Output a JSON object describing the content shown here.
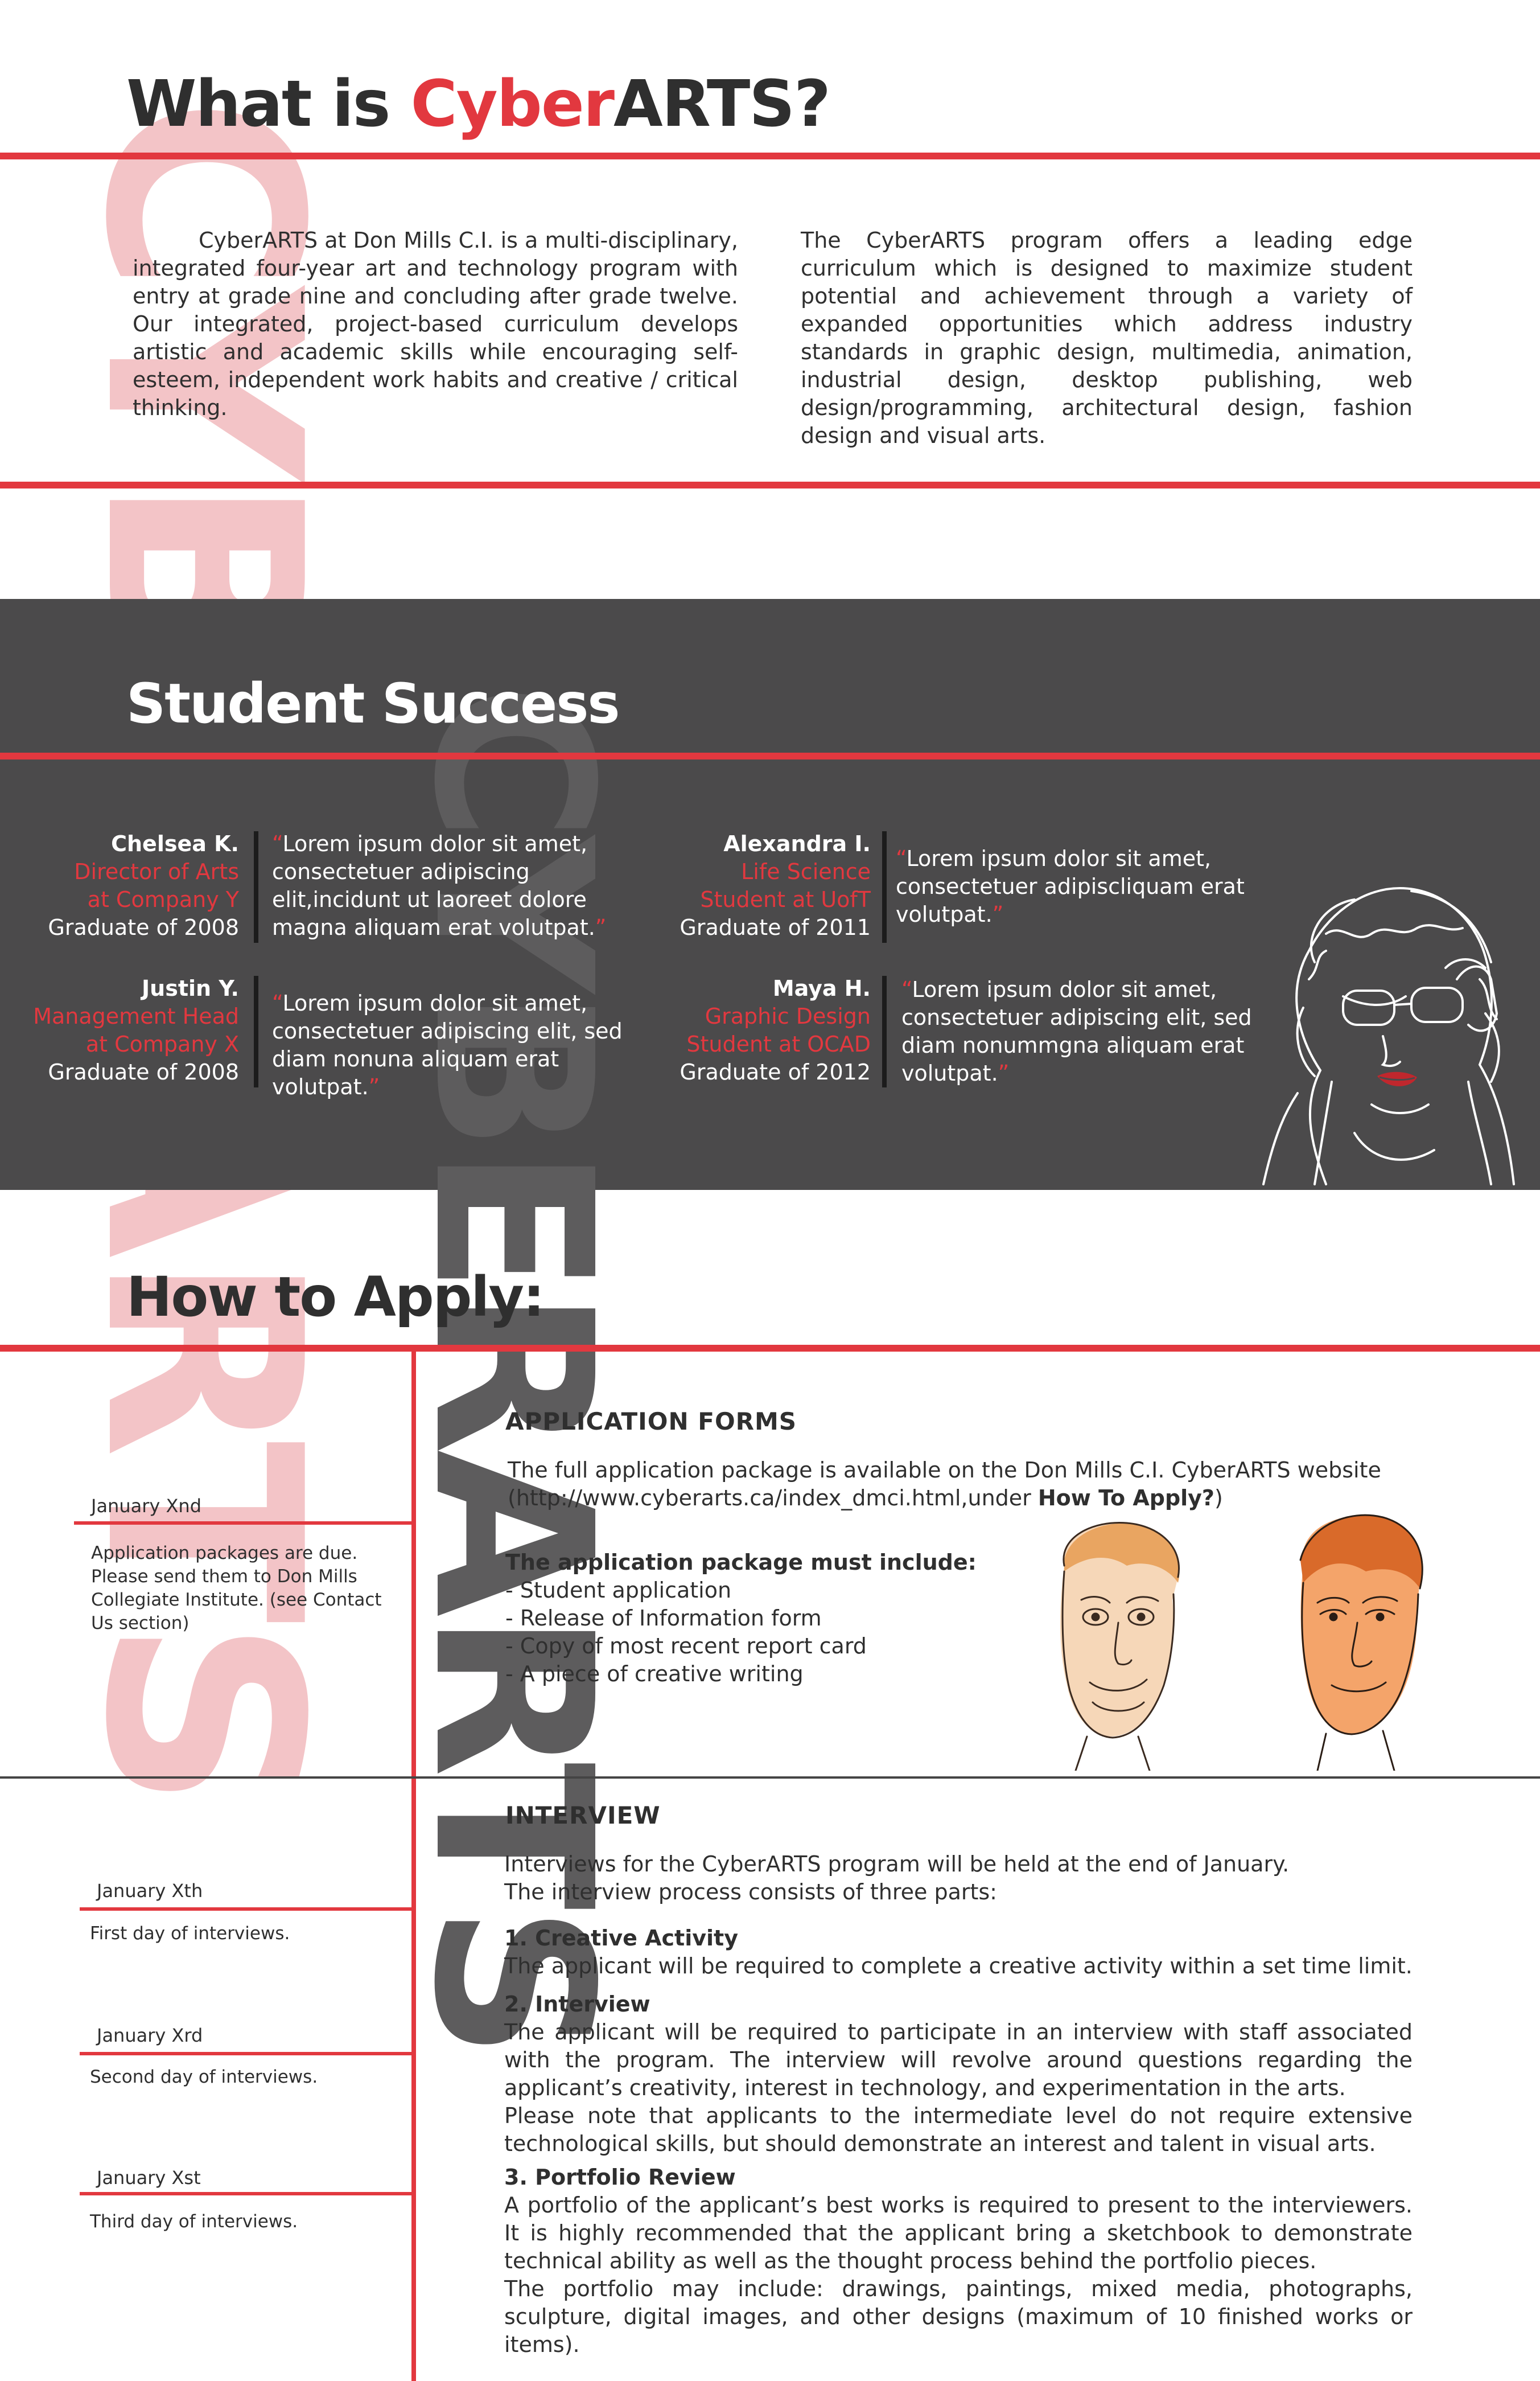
{
  "watermark": {
    "red": "CYBERARTS",
    "grey": "CYBERARTS"
  },
  "intro": {
    "title_pre": "What is ",
    "title_accent": "Cyber",
    "title_post": "ARTS?",
    "col1": "CyberARTS at Don Mills C.I. is a multi-disciplinary, integrated four-year art and technology program with entry at grade nine and concluding after grade twelve. Our integrated, project-based curriculum develops artistic and academic skills while encouraging self-esteem, independent work habits and creative / critical thinking.",
    "col2": "The CyberARTS program offers a leading edge curriculum which is designed to maximize student potential and achievement through a variety of expanded opportunities which address industry standards in graphic design, multimedia, animation, industrial design, desktop publishing, web design/programming, architectural design, fashion design and visual arts."
  },
  "success": {
    "title": "Student Success",
    "students": [
      {
        "name": "Chelsea K.",
        "role_line1": "Director of Arts",
        "role_line2": "at Company Y",
        "grad": "Graduate of 2008",
        "quote_open": "“",
        "quote": "Lorem ipsum dolor sit amet, consectetuer adipiscing elit,incidunt ut laoreet dolore magna aliquam erat volutpat.",
        "quote_close": "”"
      },
      {
        "name": "Justin Y.",
        "role_line1": "Management Head",
        "role_line2": "at Company X",
        "grad": "Graduate of 2008",
        "quote_open": "“",
        "quote": "Lorem ipsum dolor sit amet, consectetuer adipiscing elit, sed diam nonuna aliquam erat volutpat.",
        "quote_close": "”"
      },
      {
        "name": "Alexandra I.",
        "role_line1": "Life Science",
        "role_line2": "Student at UofT",
        "grad": "Graduate of 2011",
        "quote_open": "“",
        "quote": "Lorem ipsum dolor sit amet, consectetuer adipiscliquam erat volutpat.",
        "quote_close": "”"
      },
      {
        "name": "Maya H.",
        "role_line1": "Graphic Design",
        "role_line2": "Student at OCAD",
        "grad": "Graduate of 2012",
        "quote_open": "“",
        "quote": "Lorem ipsum dolor sit amet, consectetuer adipiscing elit, sed diam nonummgna aliquam erat volutpat.",
        "quote_close": "”"
      }
    ]
  },
  "apply": {
    "title": "How to Apply:",
    "forms": {
      "heading": "APPLICATION FORMS",
      "text": "The full application package is available on the Don Mills C.I. CyberARTS website (http://www.cyberarts.ca/index_dmci.html,under ",
      "text_bold": "How To Apply?",
      "text_end": ")",
      "must_heading": "The application package must include:",
      "items": [
        "- Student application",
        "- Release of Information form",
        "- Copy of most recent report card",
        "- A piece of creative writing"
      ]
    },
    "interview": {
      "heading": "INTERVIEW",
      "intro1": "Interviews for the CyberARTS program will be held at the end of January.",
      "intro2": "The interview process consists of three parts:",
      "part1_title": "1. Creative Activity",
      "part1_text": "The applicant will be required to complete a creative activity within a set time limit.",
      "part2_title": "2. Interview",
      "part2_text": "The applicant will be required to participate in an interview with staff associated with the program. The interview will revolve around questions regarding the applicant’s creativity, interest in technology, and experimentation in the arts.",
      "part2_note": "Please note that applicants to the intermediate level do not require extensive technological skills, but should demonstrate an interest and talent in visual arts.",
      "part3_title": "3. Portfolio Review",
      "part3_text": "A portfolio of the applicant’s best works is required to present to the interviewers. It is highly recommended that the applicant bring a sketchbook to demonstrate technical ability as well as the thought process behind the portfolio pieces.",
      "part3_note": "The portfolio may include: drawings, paintings, mixed media, photographs, sculpture, digital images, and other designs (maximum of 10 finished works or items)."
    },
    "timeline": [
      {
        "date": "January Xnd",
        "text": "Application packages are due. Please send them to Don Mills Collegiate Institute. (see Contact Us section)"
      },
      {
        "date": "January Xth",
        "text": "First day of interviews."
      },
      {
        "date": "January Xrd",
        "text": "Second day of interviews."
      },
      {
        "date": "January Xst",
        "text": "Third day of interviews."
      }
    ]
  },
  "colors": {
    "accent": "#e2383f",
    "dark_band": "#4b4a4b",
    "text": "#2f2f2f"
  }
}
